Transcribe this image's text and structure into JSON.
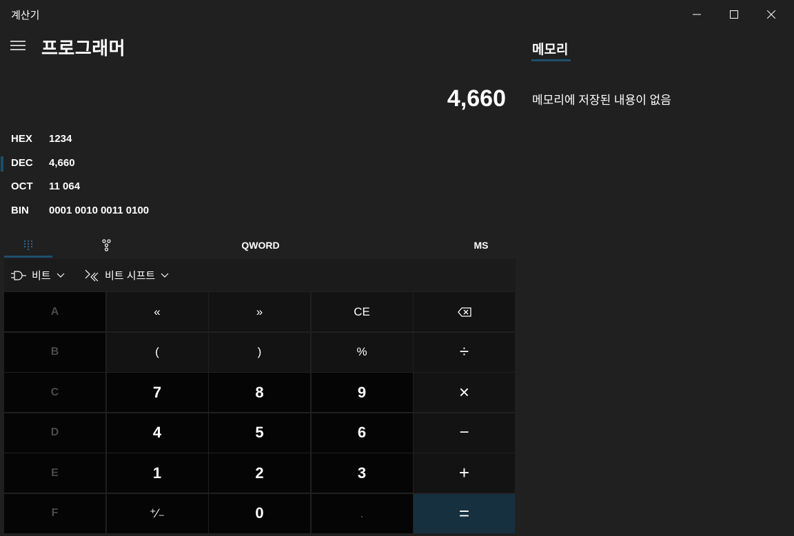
{
  "window": {
    "title": "계산기"
  },
  "header": {
    "mode_title": "프로그래머"
  },
  "display": {
    "value": "4,660"
  },
  "radix": [
    {
      "label": "HEX",
      "value": "1234",
      "selected": false
    },
    {
      "label": "DEC",
      "value": "4,660",
      "selected": true
    },
    {
      "label": "OCT",
      "value": "11 064",
      "selected": false
    },
    {
      "label": "BIN",
      "value": "0001 0010 0011 0100",
      "selected": false
    }
  ],
  "tabs": {
    "word_size": "QWORD",
    "memory_store": "MS"
  },
  "bitbar": {
    "bitwise": "비트",
    "bitshift": "비트 시프트"
  },
  "keys": {
    "A": "A",
    "lsh": "«",
    "rsh": "»",
    "CE": "CE",
    "B": "B",
    "lparen": "(",
    "rparen": ")",
    "percent": "%",
    "C": "C",
    "seven": "7",
    "eight": "8",
    "nine": "9",
    "D": "D",
    "four": "4",
    "five": "5",
    "six": "6",
    "E": "E",
    "one": "1",
    "two": "2",
    "three": "3",
    "F": "F",
    "negate": "⁺∕₋",
    "zero": "0",
    "decimal": ".",
    "divide": "÷",
    "multiply": "×",
    "minus": "−",
    "plus": "+",
    "equals": "="
  },
  "memory": {
    "title": "메모리",
    "empty_text": "메모리에 저장된 내용이 없음"
  },
  "colors": {
    "accent": "#1e4f6d",
    "equals_bg": "#173040",
    "background": "#202020"
  }
}
